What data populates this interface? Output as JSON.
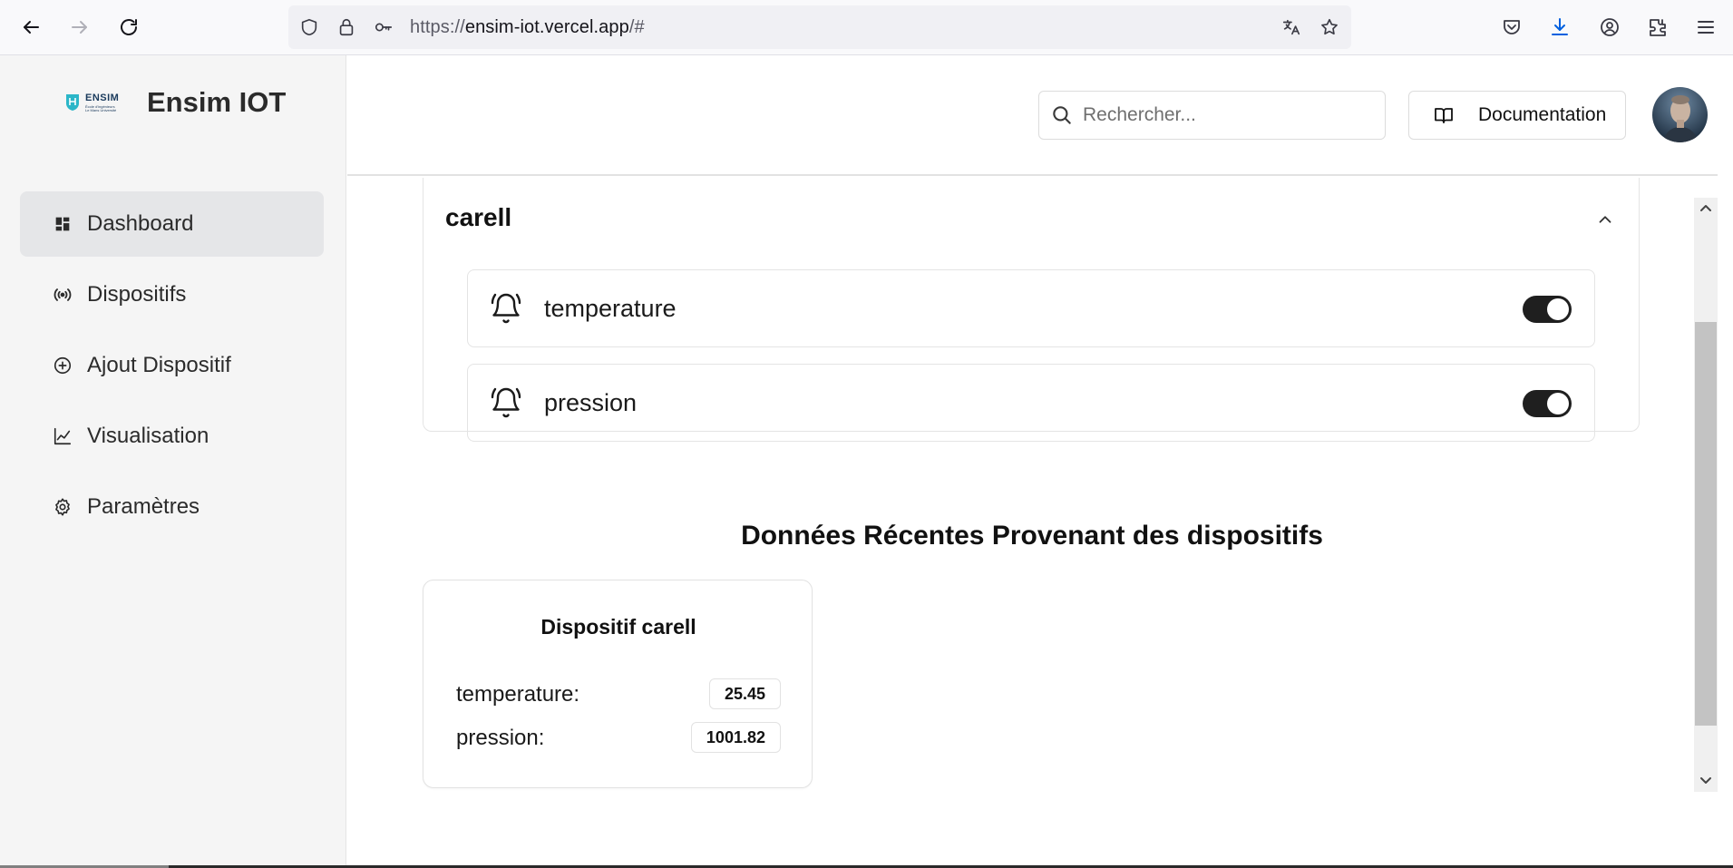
{
  "browser": {
    "url_scheme": "https://",
    "url_host": "ensim-iot.vercel.app",
    "url_path": "/#",
    "icons": [
      "back-arrow-icon",
      "forward-arrow-icon",
      "reload-icon",
      "shield-icon",
      "lock-icon",
      "key-icon",
      "translate-icon",
      "star-icon",
      "pocket-icon",
      "download-icon",
      "account-icon",
      "extensions-icon",
      "menu-icon"
    ],
    "accent": "#0060df"
  },
  "sidebar": {
    "logo": {
      "line1": "ENSIM",
      "line2": "École d'ingénieurs",
      "line3": "Le Mans Université"
    },
    "app_name": "Ensim IOT",
    "items": [
      {
        "label": "Dashboard",
        "icon": "dashboard-icon",
        "active": true
      },
      {
        "label": "Dispositifs",
        "icon": "broadcast-icon",
        "active": false
      },
      {
        "label": "Ajout Dispositif",
        "icon": "plus-circle-icon",
        "active": false
      },
      {
        "label": "Visualisation",
        "icon": "line-chart-icon",
        "active": false
      },
      {
        "label": "Paramètres",
        "icon": "gear-icon",
        "active": false
      }
    ]
  },
  "header": {
    "search_placeholder": "Rechercher...",
    "documentation_label": "Documentation"
  },
  "device_alerts": {
    "device_name": "carell",
    "alerts": [
      {
        "label": "temperature",
        "enabled": true
      },
      {
        "label": "pression",
        "enabled": true
      }
    ]
  },
  "recent": {
    "section_title": "Données Récentes Provenant des dispositifs",
    "card_title": "Dispositif carell",
    "rows": [
      {
        "key": "temperature:",
        "value": "25.45"
      },
      {
        "key": "pression:",
        "value": "1001.82"
      }
    ]
  }
}
